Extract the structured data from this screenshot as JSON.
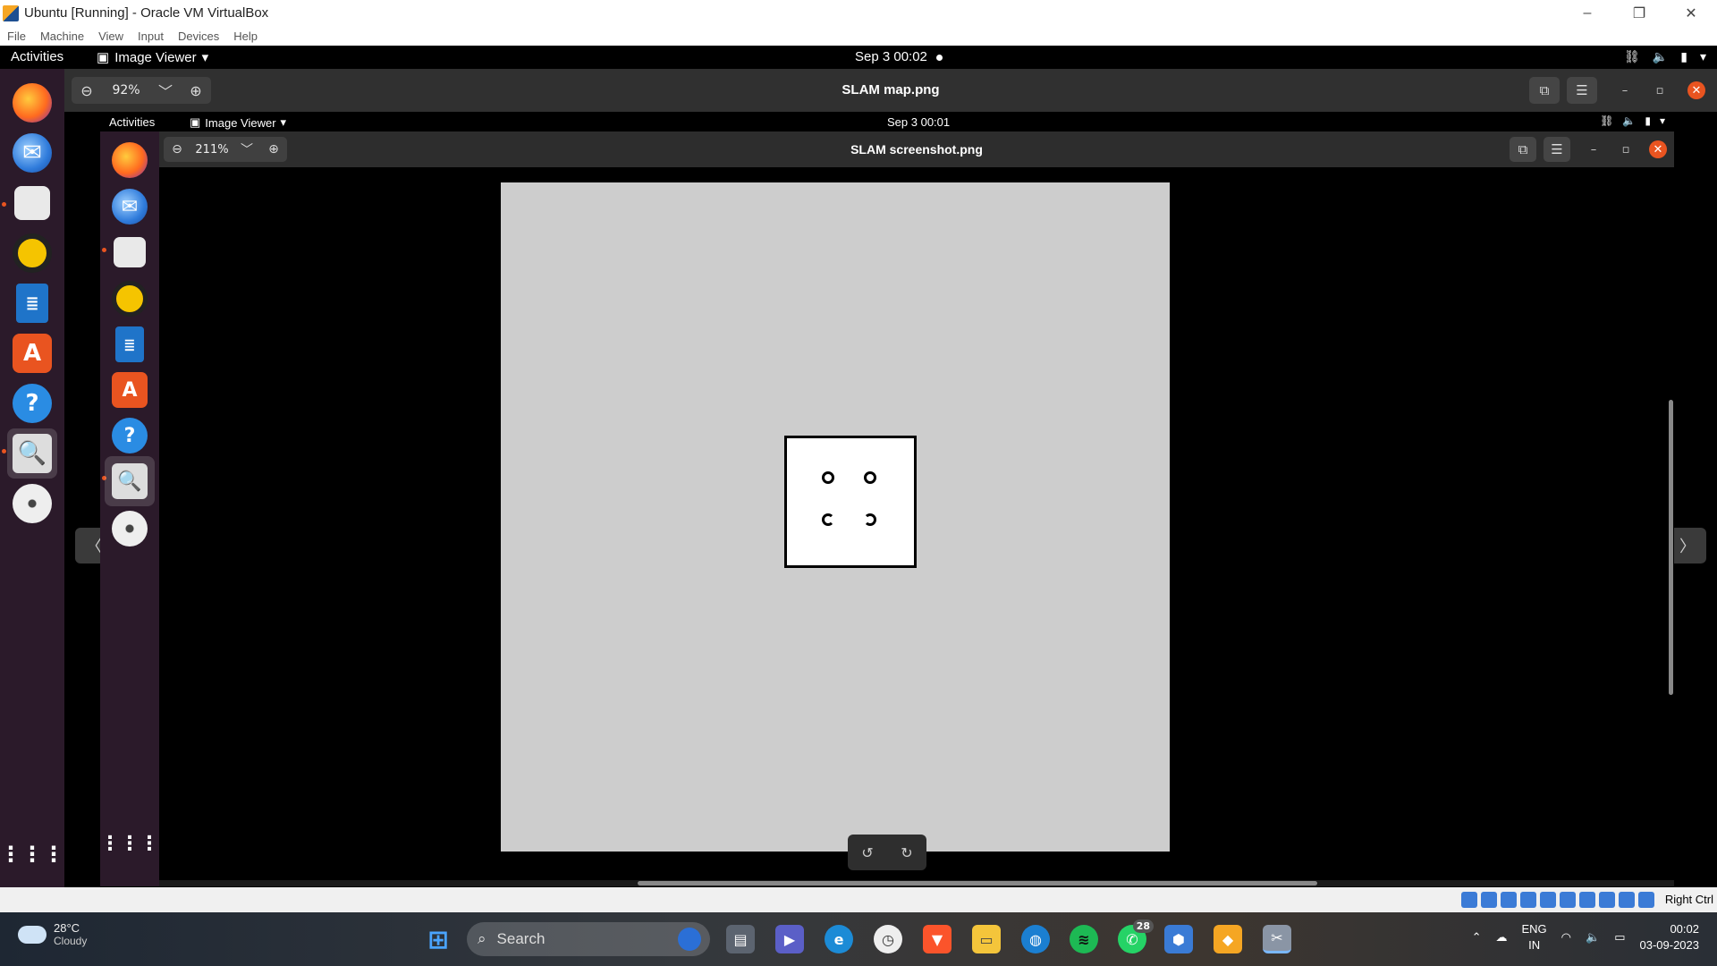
{
  "host_window": {
    "title": "Ubuntu  [Running] - Oracle VM VirtualBox",
    "menu": [
      "File",
      "Machine",
      "View",
      "Input",
      "Devices",
      "Help"
    ],
    "controls": [
      "–",
      "❐",
      "✕"
    ]
  },
  "ubuntu_topbar": {
    "activities": "Activities",
    "app_menu": "Image Viewer",
    "clock": "Sep 3  00:02"
  },
  "viewer": {
    "zoom": "92%",
    "title": "SLAM map.png"
  },
  "inner_topbar": {
    "activities": "Activities",
    "app_menu": "Image Viewer",
    "clock": "Sep 3  00:01"
  },
  "inner_viewer": {
    "zoom": "211%",
    "title": "SLAM screenshot.png"
  },
  "dock_icons": [
    "firefox-icon",
    "thunderbird-icon",
    "files-icon",
    "rhythmbox-icon",
    "writer-icon",
    "software-icon",
    "help-icon",
    "image-viewer-icon",
    "disc-icon",
    "app-grid-icon"
  ],
  "vb_status": {
    "host_key": "Right Ctrl"
  },
  "taskbar": {
    "weather_temp": "28°C",
    "weather_desc": "Cloudy",
    "search_placeholder": "Search",
    "whatsapp_badge": "28",
    "lang_line1": "ENG",
    "lang_line2": "IN",
    "time": "00:02",
    "date": "03-09-2023"
  },
  "colors": {
    "ubuntu_orange": "#e95420",
    "dock_bg": "#2b1a2a",
    "map_unknown": "#cdcdcd"
  }
}
